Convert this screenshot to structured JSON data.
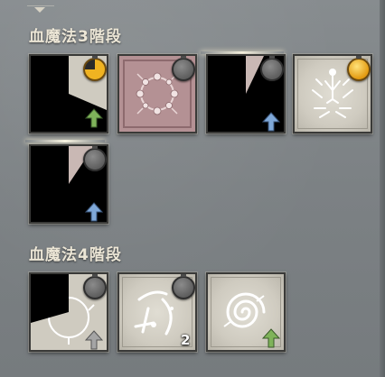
{
  "sections": [
    {
      "title": "血魔法3階段",
      "tiles": [
        {
          "name": "skill-tile-1",
          "icon": "blood-magic-skill-icon",
          "cooldown": 0.7,
          "timer": "half",
          "upgrade": "green-arrow"
        },
        {
          "name": "skill-tile-2",
          "icon": "rose-frame-icon",
          "cooldown": 0,
          "timer": "gray",
          "upgrade": "none"
        },
        {
          "name": "skill-tile-3",
          "icon": "blood-magic-skill-icon",
          "cooldown": 0.85,
          "timer": "gray",
          "upgrade": "blue-arrow"
        },
        {
          "name": "skill-tile-4",
          "icon": "blood-figure-burst-icon",
          "cooldown": 0,
          "timer": "gold",
          "upgrade": "none"
        },
        {
          "name": "skill-tile-5",
          "icon": "blood-magic-skill-icon",
          "cooldown": 0.75,
          "timer": "gray",
          "upgrade": "blue-arrow"
        }
      ]
    },
    {
      "title": "血魔法4階段",
      "tiles": [
        {
          "name": "skill-tile-6",
          "icon": "thorn-ring-icon",
          "cooldown": 0.6,
          "timer": "gray",
          "upgrade": "gray-arrow"
        },
        {
          "name": "skill-tile-7",
          "icon": "blood-slash-icon",
          "cooldown": 0,
          "timer": "gray",
          "upgrade": "none",
          "count": "2"
        },
        {
          "name": "skill-tile-8",
          "icon": "blood-vortex-icon",
          "cooldown": 0,
          "timer": "none",
          "upgrade": "green-arrow"
        }
      ]
    }
  ],
  "colors": {
    "panel": "#7f8487",
    "title_text": "#ece6d6",
    "upgrade_green": "#7fb35a",
    "upgrade_blue": "#7fa8d8",
    "timer_gold": "#f0b321",
    "timer_gray": "#6e6e6e",
    "rose_tile": "#b49194",
    "stone_tile": "#cfcbc0"
  }
}
